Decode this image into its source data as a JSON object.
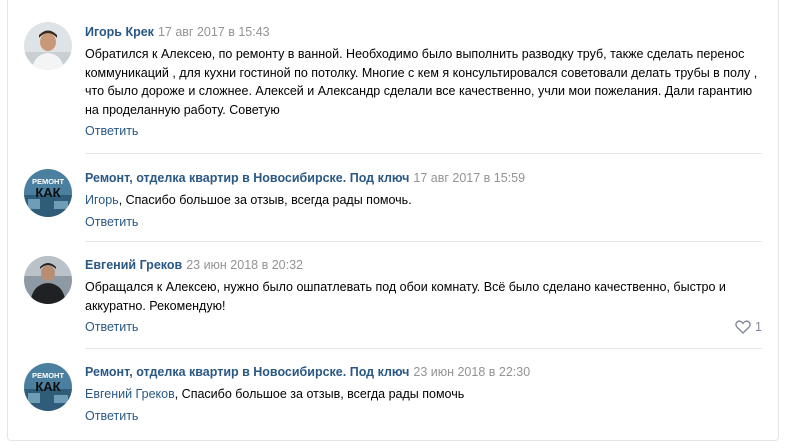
{
  "comments": [
    {
      "author": "Игорь Крек",
      "date": "17 авг 2017 в 15:43",
      "text": "Обратился к Алексею, по ремонту в ванной. Необходимо было выполнить разводку труб, также сделать перенос коммуникаций , для кухни гостиной по потолку. Многие с кем я консультировался советовали делать трубы в полу , что было дороже и сложнее. Алексей и Александр сделали все качественно, учли мои пожелания. Дали гарантию на проделанную работу. Советую",
      "reply_label": "Ответить"
    },
    {
      "author": "Ремонт, отделка квартир в Новосибирске. Под ключ",
      "date": "17 авг 2017 в 15:59",
      "mention": "Игорь",
      "text": ", Спасибо большое за отзыв, всегда рады помочь.",
      "reply_label": "Ответить",
      "avatar_text": "КАК",
      "avatar_top_text": "РЕМОНТ"
    },
    {
      "author": "Евгений Греков",
      "date": "23 июн 2018 в 20:32",
      "text": "Обращался к Алексею, нужно было ошпатлевать под обои комнату. Всё было сделано качественно, быстро и аккуратно. Рекомендую!",
      "reply_label": "Ответить",
      "likes": "1"
    },
    {
      "author": "Ремонт, отделка квартир в Новосибирске. Под ключ",
      "date": "23 июн 2018 в 22:30",
      "mention": "Евгений Греков",
      "text": ", Спасибо большое за отзыв, всегда рады помочь",
      "reply_label": "Ответить",
      "avatar_text": "КАК",
      "avatar_top_text": "РЕМОНТ"
    }
  ],
  "colors": {
    "link": "#2a5885",
    "date": "#939393",
    "separator": "#e7e8ec",
    "like_icon": "#828a99"
  }
}
